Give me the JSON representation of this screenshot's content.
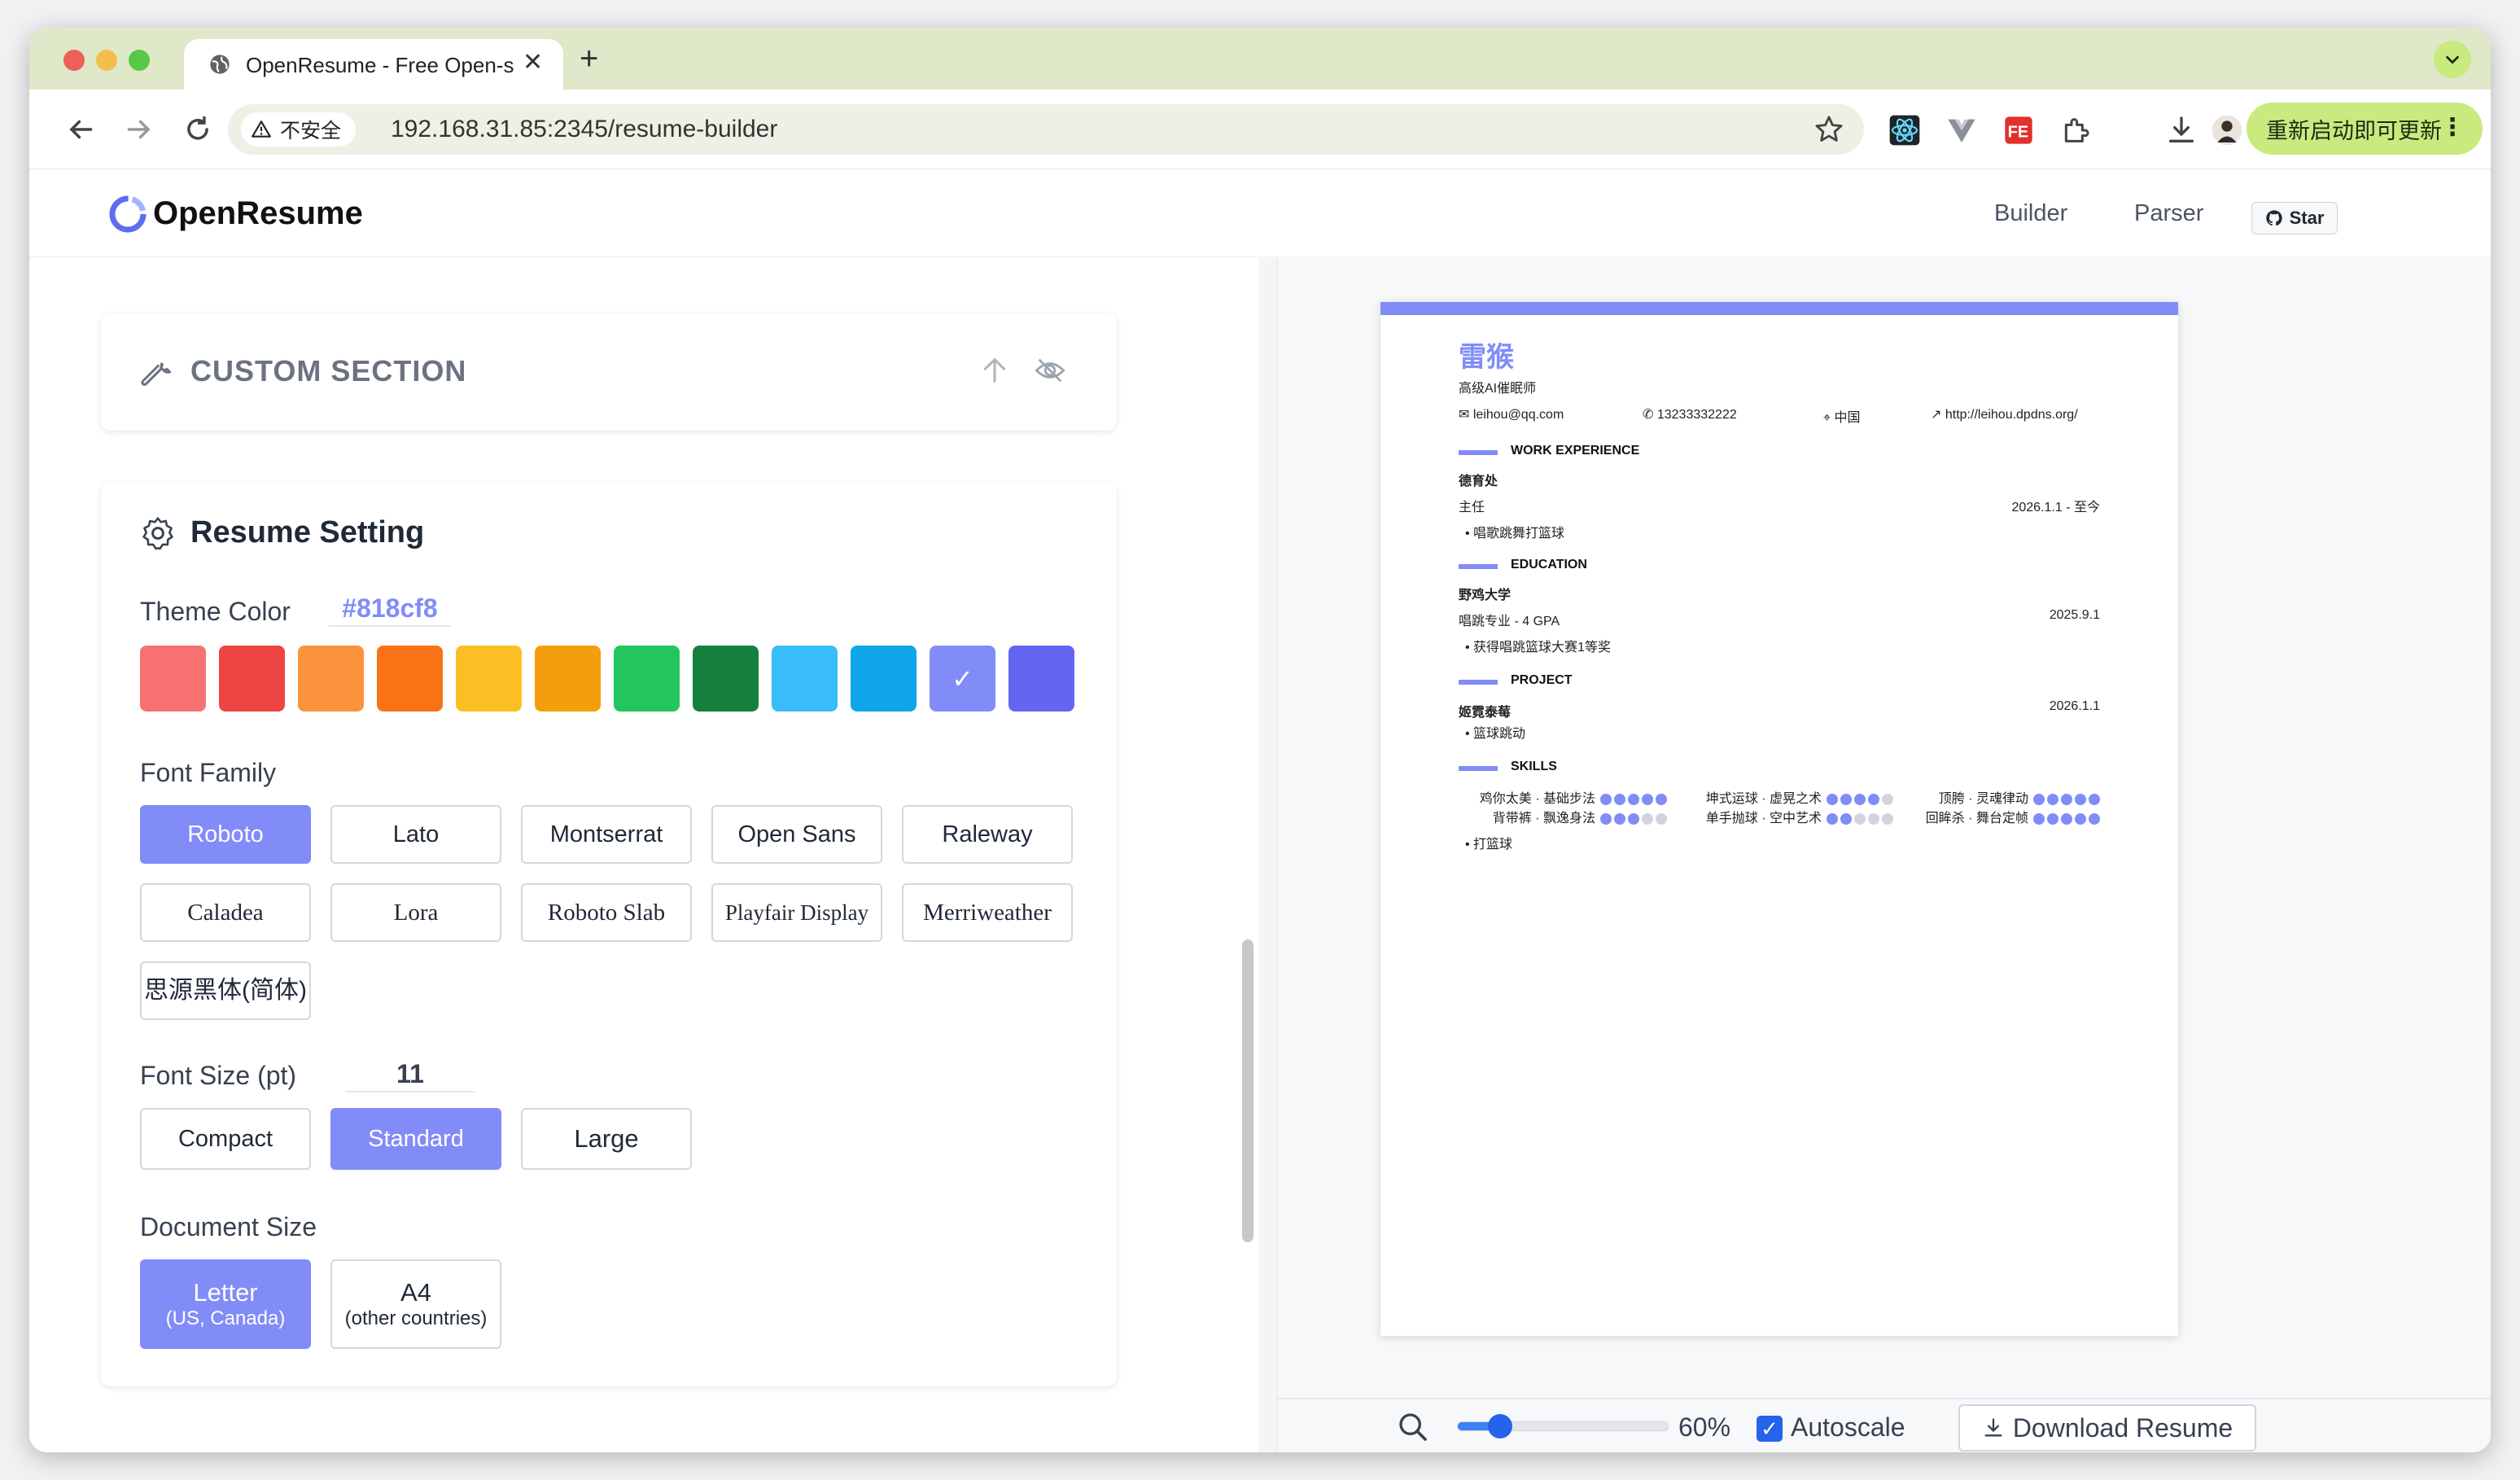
{
  "browser": {
    "tab_title": "OpenResume - Free Open-so",
    "insecure_label": "不安全",
    "url": "192.168.31.85:2345/resume-builder",
    "update_label": "重新启动即可更新"
  },
  "app": {
    "logo": "OpenResume",
    "nav_builder": "Builder",
    "nav_parser": "Parser",
    "star_label": "Star"
  },
  "custom_section": {
    "title": "CUSTOM SECTION"
  },
  "settings": {
    "title": "Resume Setting",
    "theme_label": "Theme Color",
    "theme_value": "#818cf8",
    "swatches": [
      "#f87171",
      "#ef4444",
      "#fb923c",
      "#f97316",
      "#fbbf24",
      "#f59e0b",
      "#22c55e",
      "#15803d",
      "#38bdf8",
      "#0ea5e9",
      "#818cf8",
      "#6366f1"
    ],
    "selected_swatch_mark": "✓",
    "font_family_label": "Font Family",
    "fonts": [
      "Roboto",
      "Lato",
      "Montserrat",
      "Open Sans",
      "Raleway",
      "Caladea",
      "Lora",
      "Roboto Slab",
      "Playfair Display",
      "Merriweather",
      "思源黑体(简体)"
    ],
    "font_size_label": "Font Size (pt)",
    "font_size_value": "11",
    "sizes": [
      "Compact",
      "Standard",
      "Large"
    ],
    "doc_size_label": "Document Size",
    "doc_letter": "Letter",
    "doc_letter_sub": "(US, Canada)",
    "doc_a4": "A4",
    "doc_a4_sub": "(other countries)"
  },
  "resume": {
    "name": "雷猴",
    "headline": "高级AI催眠师",
    "email": "leihou@qq.com",
    "phone": "13233332222",
    "location": "中国",
    "website": "http://leihou.dpdns.org/",
    "work_heading": "WORK EXPERIENCE",
    "work_company": "德育处",
    "work_title": "主任",
    "work_date": "2026.1.1 - 至今",
    "work_bullet": "唱歌跳舞打篮球",
    "edu_heading": "EDUCATION",
    "edu_school": "野鸡大学",
    "edu_degree": "唱跳专业 - 4 GPA",
    "edu_date": "2025.9.1",
    "edu_bullet": "获得唱跳篮球大赛1等奖",
    "project_heading": "PROJECT",
    "project_name": "姬霓泰莓",
    "project_date": "2026.1.1",
    "project_bullet": "篮球跳动",
    "skills_heading": "SKILLS",
    "skills": [
      {
        "label": "鸡你太美 · 基础步法",
        "level": 5
      },
      {
        "label": "坤式运球 · 虚晃之术",
        "level": 4
      },
      {
        "label": "顶胯 · 灵魂律动",
        "level": 5
      },
      {
        "label": "背带裤 · 飘逸身法",
        "level": 3
      },
      {
        "label": "单手抛球 · 空中艺术",
        "level": 2
      },
      {
        "label": "回眸杀 · 舞台定帧",
        "level": 5
      }
    ],
    "skills_bullet": "打篮球"
  },
  "preview": {
    "zoom_value": "60%",
    "zoom_fraction": 0.2,
    "autoscale_label": "Autoscale",
    "download_label": "Download Resume"
  }
}
